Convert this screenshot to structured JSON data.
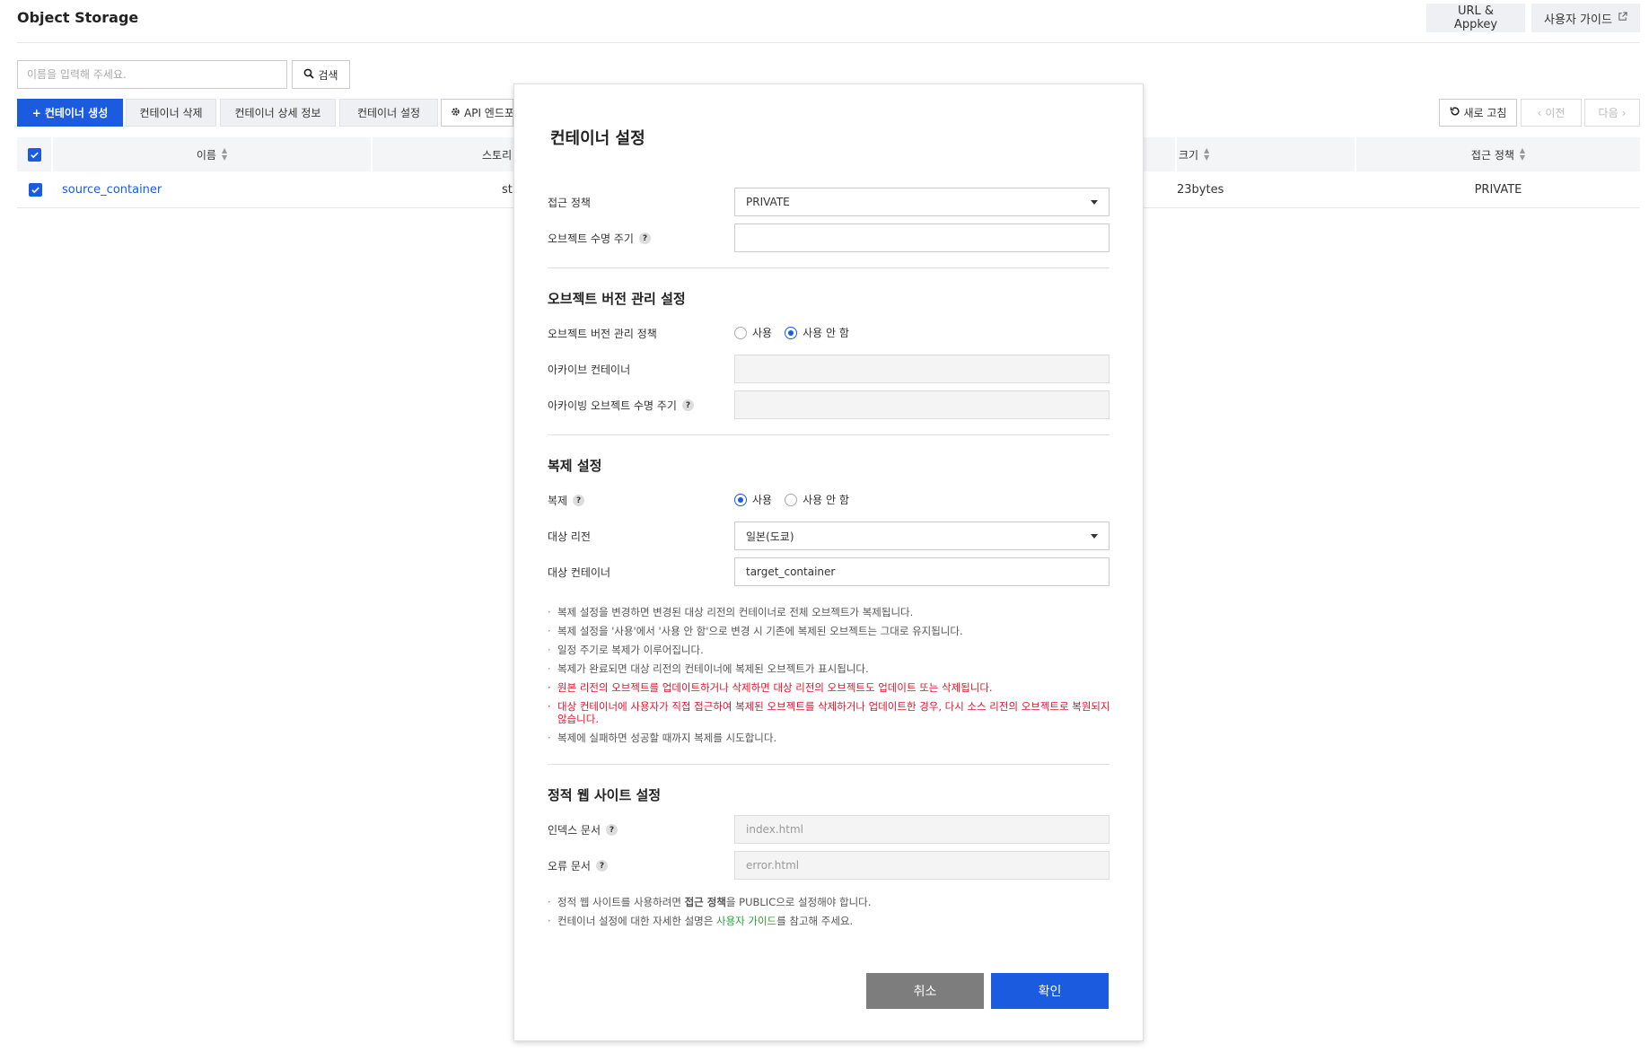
{
  "header": {
    "title": "Object Storage",
    "url_appkey": "URL & Appkey",
    "user_guide": "사용자 가이드"
  },
  "search": {
    "placeholder": "이름을 입력해 주세요.",
    "button": "검색"
  },
  "toolbar": {
    "create": "컨테이너 생성",
    "delete": "컨테이너 삭제",
    "detail": "컨테이너 상세 정보",
    "settings": "컨테이너 설정",
    "api": "API 엔드포",
    "refresh": "새로 고침",
    "prev": "이전",
    "next": "다음"
  },
  "table": {
    "columns": [
      "이름",
      "스토리",
      "크기",
      "접근 정책"
    ],
    "rows": [
      {
        "name": "source_container",
        "storage": "st",
        "size": "23bytes",
        "policy": "PRIVATE"
      }
    ]
  },
  "modal": {
    "title": "컨테이너 설정",
    "access_policy_label": "접근 정책",
    "access_policy_value": "PRIVATE",
    "lifecycle_label": "오브젝트 수명 주기",
    "lifecycle_value": "",
    "versioning_title": "오브젝트 버전 관리 설정",
    "versioning_policy_label": "오브젝트 버전 관리 정책",
    "use": "사용",
    "not_use": "사용 안 함",
    "archive_container_label": "아카이브 컨테이너",
    "archive_lifecycle_label": "아카이빙 오브젝트 수명 주기",
    "replication_title": "복제 설정",
    "replication_label": "복제",
    "target_region_label": "대상 리전",
    "target_region_value": "일본(도쿄)",
    "target_container_label": "대상 컨테이너",
    "target_container_value": "target_container",
    "replication_notes": [
      {
        "text": "복제 설정을 변경하면 변경된 대상 리전의 컨테이너로 전체 오브젝트가 복제됩니다.",
        "warn": false
      },
      {
        "text": "복제 설정을 '사용'에서 '사용 안 함'으로 변경 시 기존에 복제된 오브젝트는 그대로 유지됩니다.",
        "warn": false
      },
      {
        "text": "일정 주기로 복제가 이루어집니다.",
        "warn": false
      },
      {
        "text": "복제가 완료되면 대상 리전의 컨테이너에 복제된 오브젝트가 표시됩니다.",
        "warn": false
      },
      {
        "text": "원본 리전의 오브젝트를 업데이트하거나 삭제하면 대상 리전의 오브젝트도 업데이트 또는 삭제됩니다.",
        "warn": true
      },
      {
        "text": "대상 컨테이너에 사용자가 직접 접근하여 복제된 오브젝트를 삭제하거나 업데이트한 경우, 다시 소스 리전의 오브젝트로 복원되지 않습니다.",
        "warn": true
      },
      {
        "text": "복제에 실패하면 성공할 때까지 복제를 시도합니다.",
        "warn": false
      }
    ],
    "website_title": "정적 웹 사이트 설정",
    "index_doc_label": "인덱스 문서",
    "index_doc_placeholder": "index.html",
    "error_doc_label": "오류 문서",
    "error_doc_placeholder": "error.html",
    "website_note1_prefix": "정적 웹 사이트를 사용하려면 ",
    "website_note1_bold": "접근 정책",
    "website_note1_suffix": "을 PUBLIC으로 설정해야 합니다.",
    "website_note2_prefix": "컨테이너 설정에 대한 자세한 설명은 ",
    "website_note2_link": "사용자 가이드",
    "website_note2_suffix": "를 참고해 주세요.",
    "cancel": "취소",
    "confirm": "확인"
  },
  "colors": {
    "primary": "#1a5be0",
    "warning": "#e0152b",
    "link_green": "#2a9d3a",
    "cancel_gray": "#7d7d7d"
  }
}
